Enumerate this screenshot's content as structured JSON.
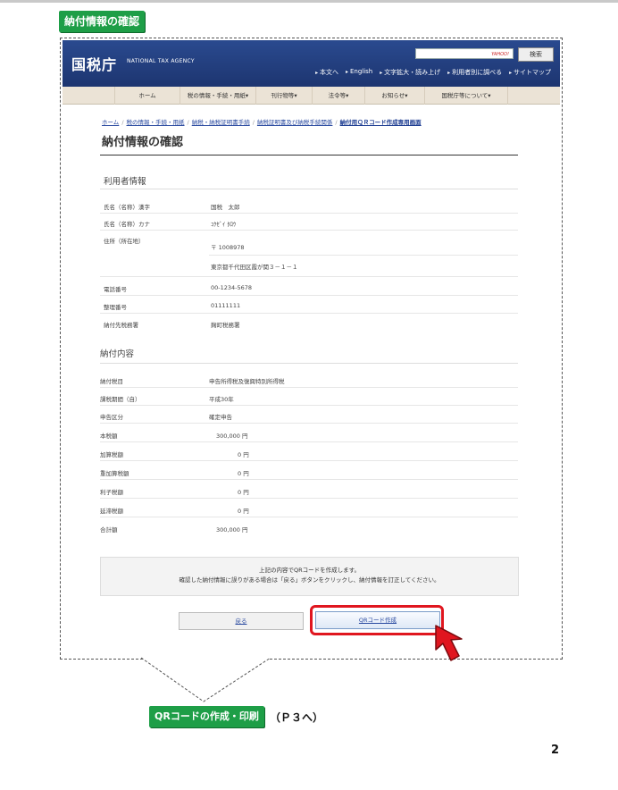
{
  "step_label": "納付情報の確認",
  "site": {
    "logo": "国税庁",
    "logo_sub": "NATIONAL TAX AGENCY",
    "search_brand": "YAHOO!",
    "search_button": "検索",
    "util_links": [
      "本文へ",
      "English",
      "文字拡大・読み上げ",
      "利用者別に調べる",
      "サイトマップ"
    ],
    "gnav": [
      "ホーム",
      "税の情報・手続・用紙▾",
      "刊行物等▾",
      "法令等▾",
      "お知らせ▾",
      "国税庁等について▾"
    ]
  },
  "breadcrumb": {
    "items": [
      "ホーム",
      "税の情報・手続・用紙",
      "納税・納税証明書手続",
      "納税証明書及び納税手続関係"
    ],
    "current": "納付用ＱＲコード作成専用画面"
  },
  "page_title": "納付情報の確認",
  "user_info": {
    "title": "利用者情報",
    "rows": [
      {
        "label": "氏名（名称）漢字",
        "value": "国税　太郎"
      },
      {
        "label": "氏名（名称）カナ",
        "value": "ｺｸｾﾞｲ ﾀﾛｳ"
      },
      {
        "label": "住所（所在地）",
        "value": "〒 1008978"
      },
      {
        "label": "",
        "value": "東京都千代田区霞が関３－１－１"
      },
      {
        "label": "電話番号",
        "value": "00-1234-5678"
      },
      {
        "label": "整理番号",
        "value": "01111111"
      },
      {
        "label": "納付先税務署",
        "value": "麹町税務署"
      }
    ]
  },
  "payment": {
    "title": "納付内容",
    "rows": [
      {
        "label": "納付税目",
        "value": "申告所得税及復興特別所得税"
      },
      {
        "label": "課税期間（自）",
        "value": "平成30年"
      },
      {
        "label": "申告区分",
        "value": "確定申告"
      },
      {
        "label": "本税額",
        "value": "300,000 円"
      },
      {
        "label": "加算税額",
        "value": "0 円"
      },
      {
        "label": "重加算税額",
        "value": "0 円"
      },
      {
        "label": "利子税額",
        "value": "0 円"
      },
      {
        "label": "延滞税額",
        "value": "0 円"
      },
      {
        "label": "合計額",
        "value": "300,000 円"
      }
    ]
  },
  "note": [
    "上記の内容でQRコードを作成します。",
    "確認した納付情報に誤りがある場合は「戻る」ボタンをクリックし、納付情報を訂正してください。"
  ],
  "buttons": {
    "back": "戻る",
    "create_qr": "QRコード作成"
  },
  "next_step_label": "QRコードの作成・印刷",
  "next_step_ref": "（Ｐ３へ）",
  "page_number": "2",
  "colors": {
    "header_blue": "#1f3c7a",
    "step_green": "#1e9e47",
    "highlight_red": "#e0161f"
  },
  "icons": [
    "cursor-arrow-icon"
  ]
}
